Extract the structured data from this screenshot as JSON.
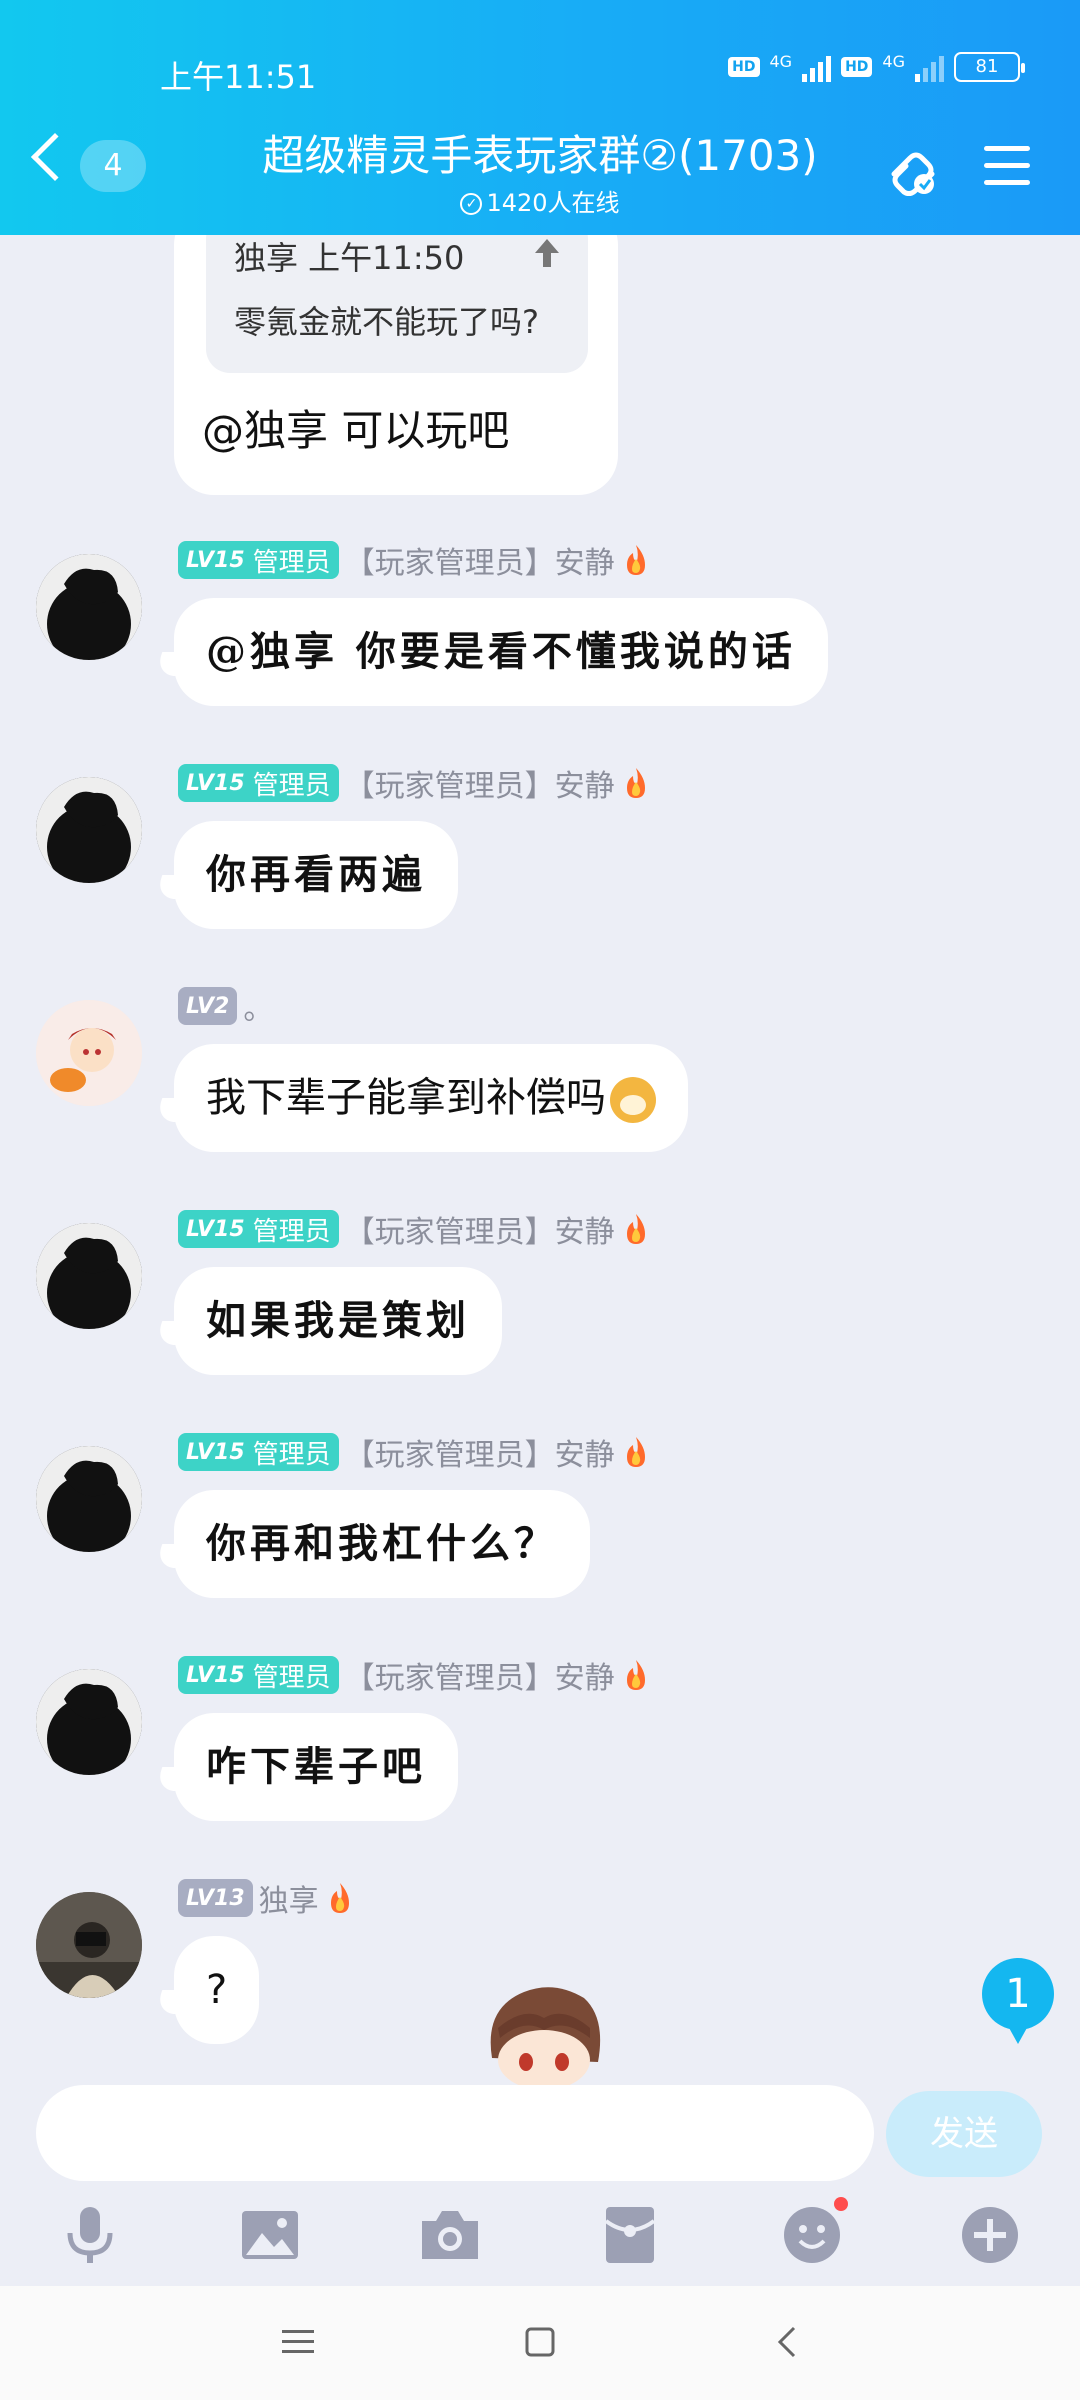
{
  "status_bar": {
    "time": "上午11:51",
    "hd1": "HD",
    "net1": "4G",
    "hd2": "HD",
    "net2": "4G",
    "battery": "81"
  },
  "header": {
    "back_count": "4",
    "title": "超级精灵手表玩家群②(1703)",
    "online_text": "1420人在线",
    "accent_color": "#18acf6"
  },
  "quoted_message": {
    "meta": "独享 上午11:50",
    "text": "零氪金就不能玩了吗?",
    "reply": "@独享 可以玩吧"
  },
  "messages": [
    {
      "level": "LV15",
      "role": "管理员",
      "sender": "【玩家管理员】安静",
      "text": "@独享 你要是看不懂我说的话"
    },
    {
      "level": "LV15",
      "role": "管理员",
      "sender": "【玩家管理员】安静",
      "text": "你再看两遍"
    },
    {
      "level": "LV2",
      "role": "",
      "sender": "。",
      "text": "我下辈子能拿到补偿吗"
    },
    {
      "level": "LV15",
      "role": "管理员",
      "sender": "【玩家管理员】安静",
      "text": "如果我是策划"
    },
    {
      "level": "LV15",
      "role": "管理员",
      "sender": "【玩家管理员】安静",
      "text": "你再和我杠什么？"
    },
    {
      "level": "LV15",
      "role": "管理员",
      "sender": "【玩家管理员】安静",
      "text": "咋下辈子吧"
    },
    {
      "level": "LV13",
      "role": "",
      "sender": "独享",
      "text": "?"
    }
  ],
  "new_message_count": "1",
  "input": {
    "placeholder": "",
    "send_label": "发送"
  },
  "toolbar_icons": [
    "microphone-icon",
    "image-icon",
    "camera-icon",
    "red-packet-icon",
    "emoji-icon",
    "plus-icon"
  ]
}
